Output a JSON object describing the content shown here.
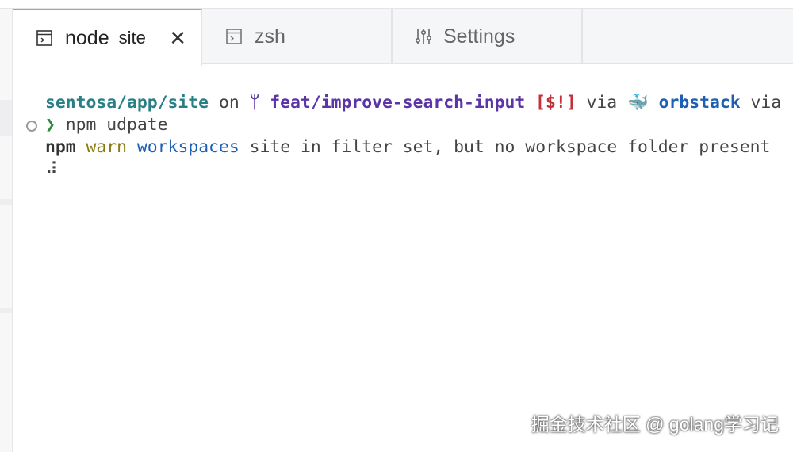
{
  "tabs": [
    {
      "label": "node",
      "sublabel": "site",
      "icon": "terminal-icon",
      "active": true
    },
    {
      "label": "zsh",
      "icon": "terminal-icon",
      "active": false
    },
    {
      "label": "Settings",
      "icon": "sliders-icon",
      "active": false
    }
  ],
  "terminal": {
    "prompt": {
      "path": "sentosa/app/site",
      "on": " on ",
      "branch_icon": "",
      "branch": " feat/improve-search-input",
      "status": " [$!]",
      "via1": " via ",
      "whale": "🐳",
      "context": " orbstack",
      "via2": " via"
    },
    "prompt_char": "❯",
    "command": " npm udpate",
    "output": {
      "npm": "npm",
      "level": " warn",
      "topic": " workspaces",
      "message": " site in filter set, but no workspace folder present"
    },
    "spinner": "⠼"
  },
  "watermark": "掘金技术社区 @ golang学习记"
}
